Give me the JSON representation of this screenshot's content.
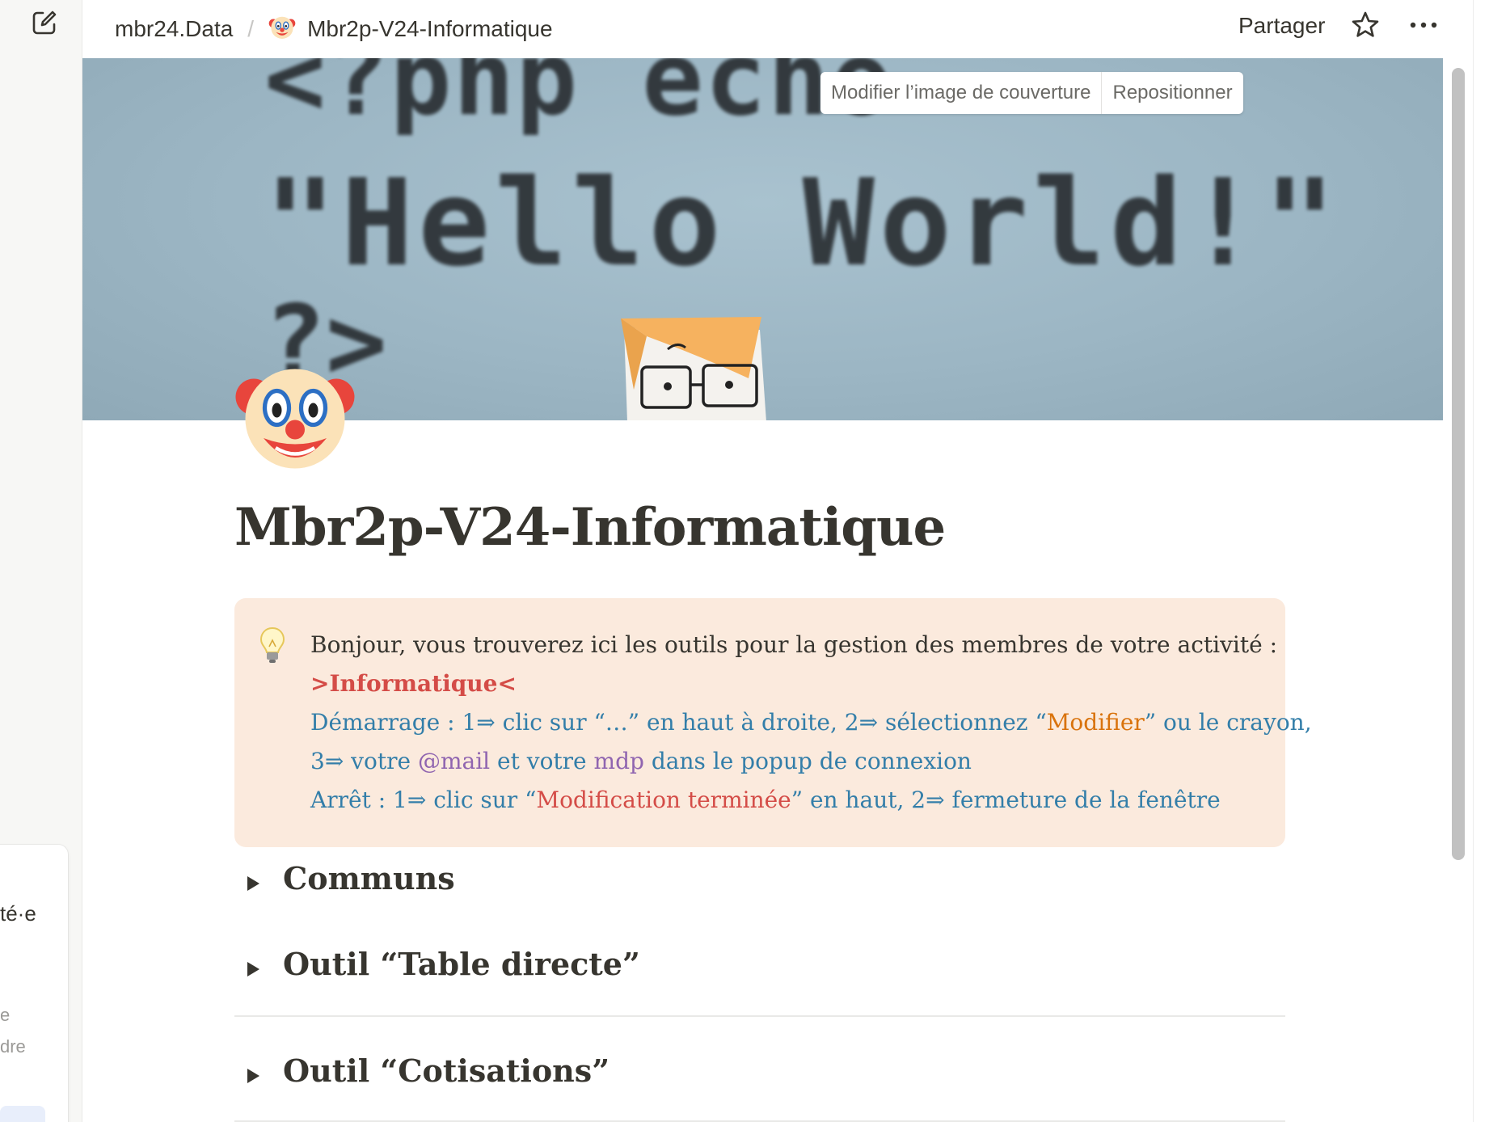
{
  "sidebar": {
    "new_page_icon": "compose-icon",
    "fragments": [
      "té·e",
      "e",
      "dre"
    ]
  },
  "topbar": {
    "breadcrumb": {
      "workspace": "mbr24.Data",
      "separator": "/",
      "page_icon": "clown-face-icon",
      "page": "Mbr2p-V24-Informatique"
    },
    "share_label": "Partager",
    "favorite_icon": "star-icon",
    "more_icon": "more-dots-icon"
  },
  "cover": {
    "image_text_lines": [
      "<?php echo",
      "\"Hello World!\"",
      "?>"
    ],
    "change_cover_label": "Modifier l’image de couverture",
    "reposition_label": "Repositionner"
  },
  "page": {
    "icon": "clown-face-icon",
    "title": "Mbr2p-V24-Informatique"
  },
  "callout": {
    "icon": "lightbulb-icon",
    "background": "#fbeadd",
    "line1": "Bonjour, vous trouverez ici les outils pour la gestion des membres de votre activité :",
    "line2": ">Informatique<",
    "line3_a": "Démarrage : 1⇒ clic sur “…” en haut à droite, 2⇒ sélectionnez “",
    "line3_b": "Modifier",
    "line3_c": "” ou le crayon,",
    "line4_a": "3⇒ votre ",
    "line4_b": "@mail",
    "line4_c": " et votre ",
    "line4_d": "mdp",
    "line4_e": " dans le popup de connexion",
    "line5_a": "Arrêt : 1⇒ clic sur “",
    "line5_b": "Modification terminée",
    "line5_c": "” en haut, 2⇒ fermeture de la fenêtre"
  },
  "toggles": [
    {
      "label": "Communs",
      "icon": "toggle-triangle-icon"
    },
    {
      "label": "Outil “Table directe”",
      "icon": "toggle-triangle-icon"
    },
    {
      "label": "Outil “Cotisations”",
      "icon": "toggle-triangle-icon"
    }
  ],
  "colors": {
    "text": "#37352f",
    "red": "#d44c47",
    "blue": "#337ea9",
    "orange": "#d9730d",
    "purple": "#9065b0",
    "callout_bg": "#fbeadd",
    "cover": "#9cb6c4"
  }
}
